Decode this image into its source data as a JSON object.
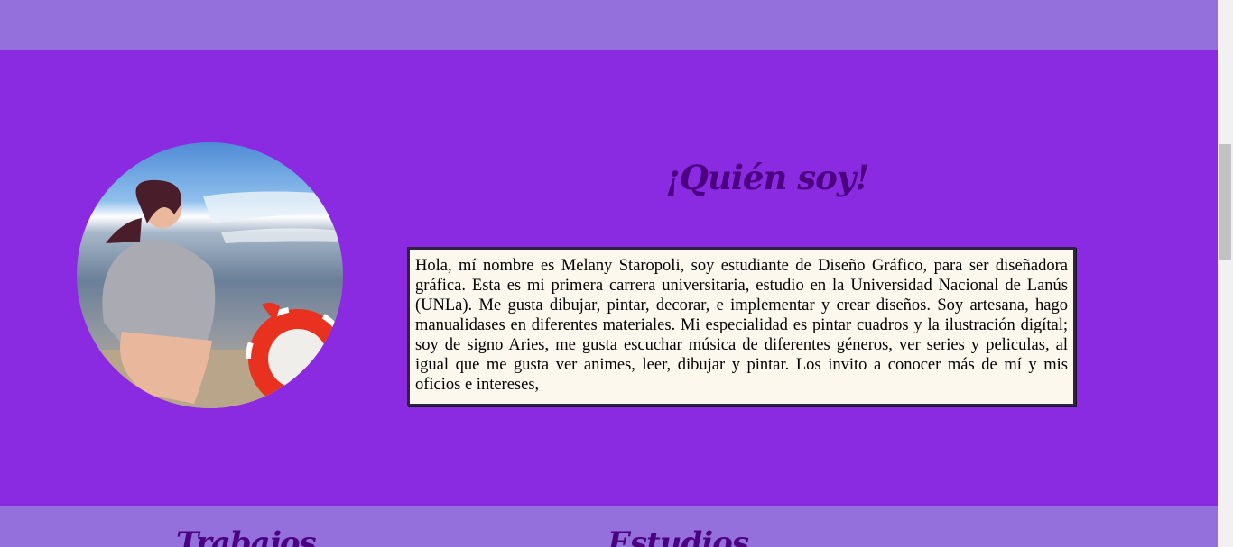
{
  "about": {
    "title": "¡Quién soy!",
    "bio": "Hola, mí nombre es Melany Staropoli, soy estudiante de Diseño Gráfico, para ser diseñadora gráfica. Esta es mi primera carrera universitaria, estudio en la Universidad Nacional de Lanús (UNLa). Me gusta dibujar, pintar, decorar, e implementar y crear diseños. Soy artesana, hago manualidases en diferentes materiales. Mi especialidad es pintar cuadros y la ilustración digítal; soy de signo Aries, me gusta escuchar música de diferentes géneros, ver series y peliculas, al igual que me gusta ver animes, leer, dibujar y pintar. Los invito a conocer más de mí y mis oficios e intereses,"
  },
  "sections": {
    "works_title": "Trabajos",
    "studies_title": "Estudios"
  },
  "colors": {
    "about_bg": "#8a2be2",
    "band_bg": "#9370db",
    "title": "#4b0082",
    "bio_bg": "#fdf8ee"
  }
}
